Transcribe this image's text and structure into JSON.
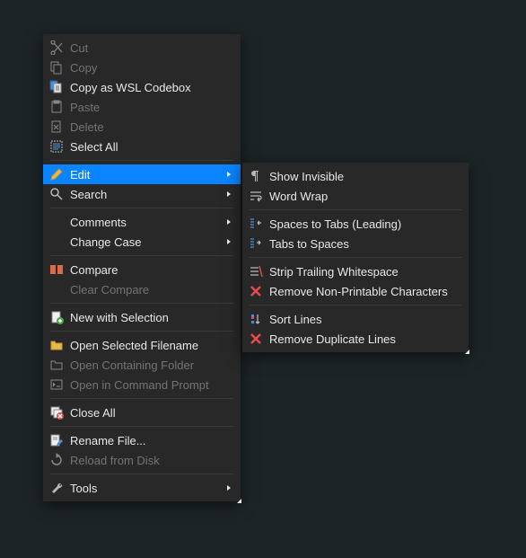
{
  "main_menu": {
    "groups": [
      {
        "items": [
          {
            "id": "cut",
            "label": "Cut",
            "icon": "scissors",
            "disabled": true,
            "submenu": false
          },
          {
            "id": "copy",
            "label": "Copy",
            "icon": "copy",
            "disabled": true,
            "submenu": false
          },
          {
            "id": "copy-wsl",
            "label": "Copy as WSL Codebox",
            "icon": "copy-stack",
            "disabled": false,
            "submenu": false
          },
          {
            "id": "paste",
            "label": "Paste",
            "icon": "clipboard",
            "disabled": true,
            "submenu": false
          },
          {
            "id": "delete",
            "label": "Delete",
            "icon": "delete-file",
            "disabled": true,
            "submenu": false
          },
          {
            "id": "select-all",
            "label": "Select All",
            "icon": "select-all",
            "disabled": false,
            "submenu": false
          }
        ]
      },
      {
        "items": [
          {
            "id": "edit",
            "label": "Edit",
            "icon": "pencil",
            "disabled": false,
            "submenu": true,
            "highlighted": true
          },
          {
            "id": "search",
            "label": "Search",
            "icon": "search",
            "disabled": false,
            "submenu": true
          }
        ]
      },
      {
        "items": [
          {
            "id": "comments",
            "label": "Comments",
            "icon": "",
            "disabled": false,
            "submenu": true
          },
          {
            "id": "change-case",
            "label": "Change Case",
            "icon": "",
            "disabled": false,
            "submenu": true
          }
        ]
      },
      {
        "items": [
          {
            "id": "compare",
            "label": "Compare",
            "icon": "compare",
            "disabled": false,
            "submenu": false
          },
          {
            "id": "clear-compare",
            "label": "Clear Compare",
            "icon": "",
            "disabled": true,
            "submenu": false
          }
        ]
      },
      {
        "items": [
          {
            "id": "new-selection",
            "label": "New with Selection",
            "icon": "new-file",
            "disabled": false,
            "submenu": false
          }
        ]
      },
      {
        "items": [
          {
            "id": "open-filename",
            "label": "Open Selected Filename",
            "icon": "open-file",
            "disabled": false,
            "submenu": false
          },
          {
            "id": "open-folder",
            "label": "Open Containing Folder",
            "icon": "folder",
            "disabled": true,
            "submenu": false
          },
          {
            "id": "open-cmd",
            "label": "Open in Command Prompt",
            "icon": "terminal",
            "disabled": true,
            "submenu": false
          }
        ]
      },
      {
        "items": [
          {
            "id": "close-all",
            "label": "Close All",
            "icon": "close-all",
            "disabled": false,
            "submenu": false
          }
        ]
      },
      {
        "items": [
          {
            "id": "rename",
            "label": "Rename File...",
            "icon": "rename",
            "disabled": false,
            "submenu": false
          },
          {
            "id": "reload",
            "label": "Reload from Disk",
            "icon": "reload",
            "disabled": true,
            "submenu": false
          }
        ]
      },
      {
        "items": [
          {
            "id": "tools",
            "label": "Tools",
            "icon": "wrench",
            "disabled": false,
            "submenu": true
          }
        ]
      }
    ]
  },
  "sub_menu": {
    "groups": [
      {
        "items": [
          {
            "id": "show-invisible",
            "label": "Show Invisible",
            "icon": "pilcrow",
            "disabled": false
          },
          {
            "id": "word-wrap",
            "label": "Word Wrap",
            "icon": "wrap",
            "disabled": false
          }
        ]
      },
      {
        "items": [
          {
            "id": "spaces-tabs",
            "label": "Spaces to Tabs (Leading)",
            "icon": "indent-left",
            "disabled": false
          },
          {
            "id": "tabs-spaces",
            "label": "Tabs to Spaces",
            "icon": "indent-right",
            "disabled": false
          }
        ]
      },
      {
        "items": [
          {
            "id": "strip-trailing",
            "label": "Strip Trailing Whitespace",
            "icon": "strip",
            "disabled": false
          },
          {
            "id": "remove-nonprint",
            "label": "Remove Non-Printable Characters",
            "icon": "remove-red",
            "disabled": false
          }
        ]
      },
      {
        "items": [
          {
            "id": "sort-lines",
            "label": "Sort Lines",
            "icon": "sort",
            "disabled": false
          },
          {
            "id": "remove-dup",
            "label": "Remove Duplicate Lines",
            "icon": "remove-red",
            "disabled": false
          }
        ]
      }
    ]
  }
}
